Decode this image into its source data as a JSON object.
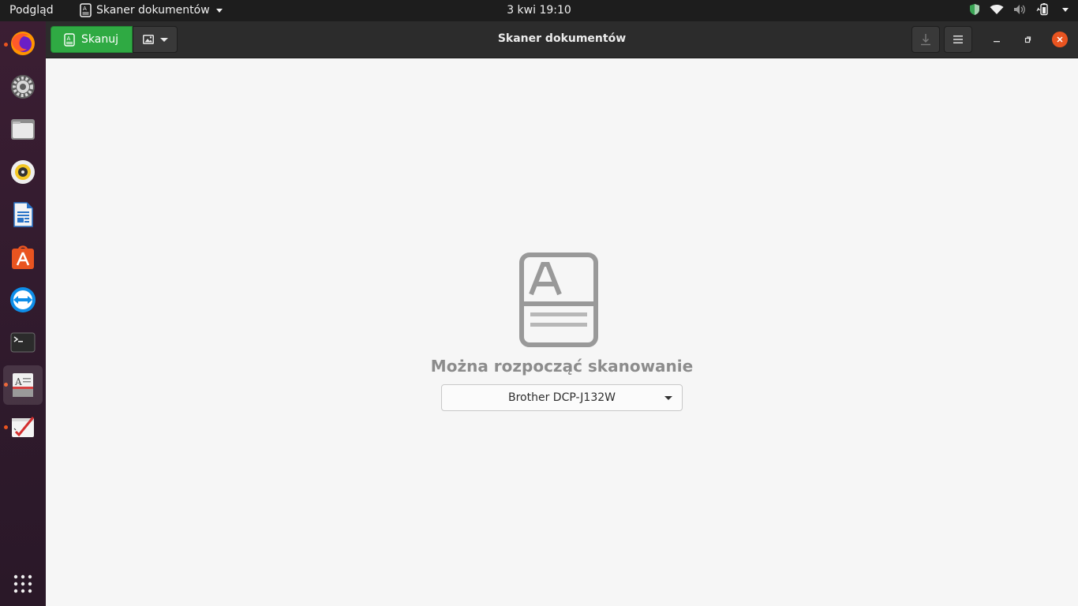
{
  "topbar": {
    "activities": "Podgląd",
    "app_menu": "Skaner dokumentów",
    "clock": "3 kwi  19:10",
    "tray_icons": [
      "shield-icon",
      "wifi-icon",
      "volume-icon",
      "battery-icon"
    ]
  },
  "dock": {
    "items": [
      {
        "icon": "firefox-icon",
        "running": true
      },
      {
        "icon": "settings-icon",
        "running": false
      },
      {
        "icon": "files-icon",
        "running": false
      },
      {
        "icon": "rhythmbox-icon",
        "running": false
      },
      {
        "icon": "writer-icon",
        "running": false
      },
      {
        "icon": "software-icon",
        "running": false
      },
      {
        "icon": "teamviewer-icon",
        "running": false
      },
      {
        "icon": "terminal-icon",
        "running": false
      },
      {
        "icon": "document-scanner-icon",
        "running": true,
        "active": true
      },
      {
        "icon": "text-editor-icon",
        "running": true
      }
    ],
    "show_apps_icon": "apps-grid-icon"
  },
  "window": {
    "title": "Skaner dokumentów",
    "scan_button": "Skanuj",
    "scan_type_icon": "photo-icon",
    "save_icon": "download-icon",
    "menu_icon": "hamburger-menu-icon",
    "accent": "#2faa43",
    "close_color": "#e95420"
  },
  "content": {
    "status": "Można rozpocząć skanowanie",
    "device": "Brother DCP-J132W"
  }
}
